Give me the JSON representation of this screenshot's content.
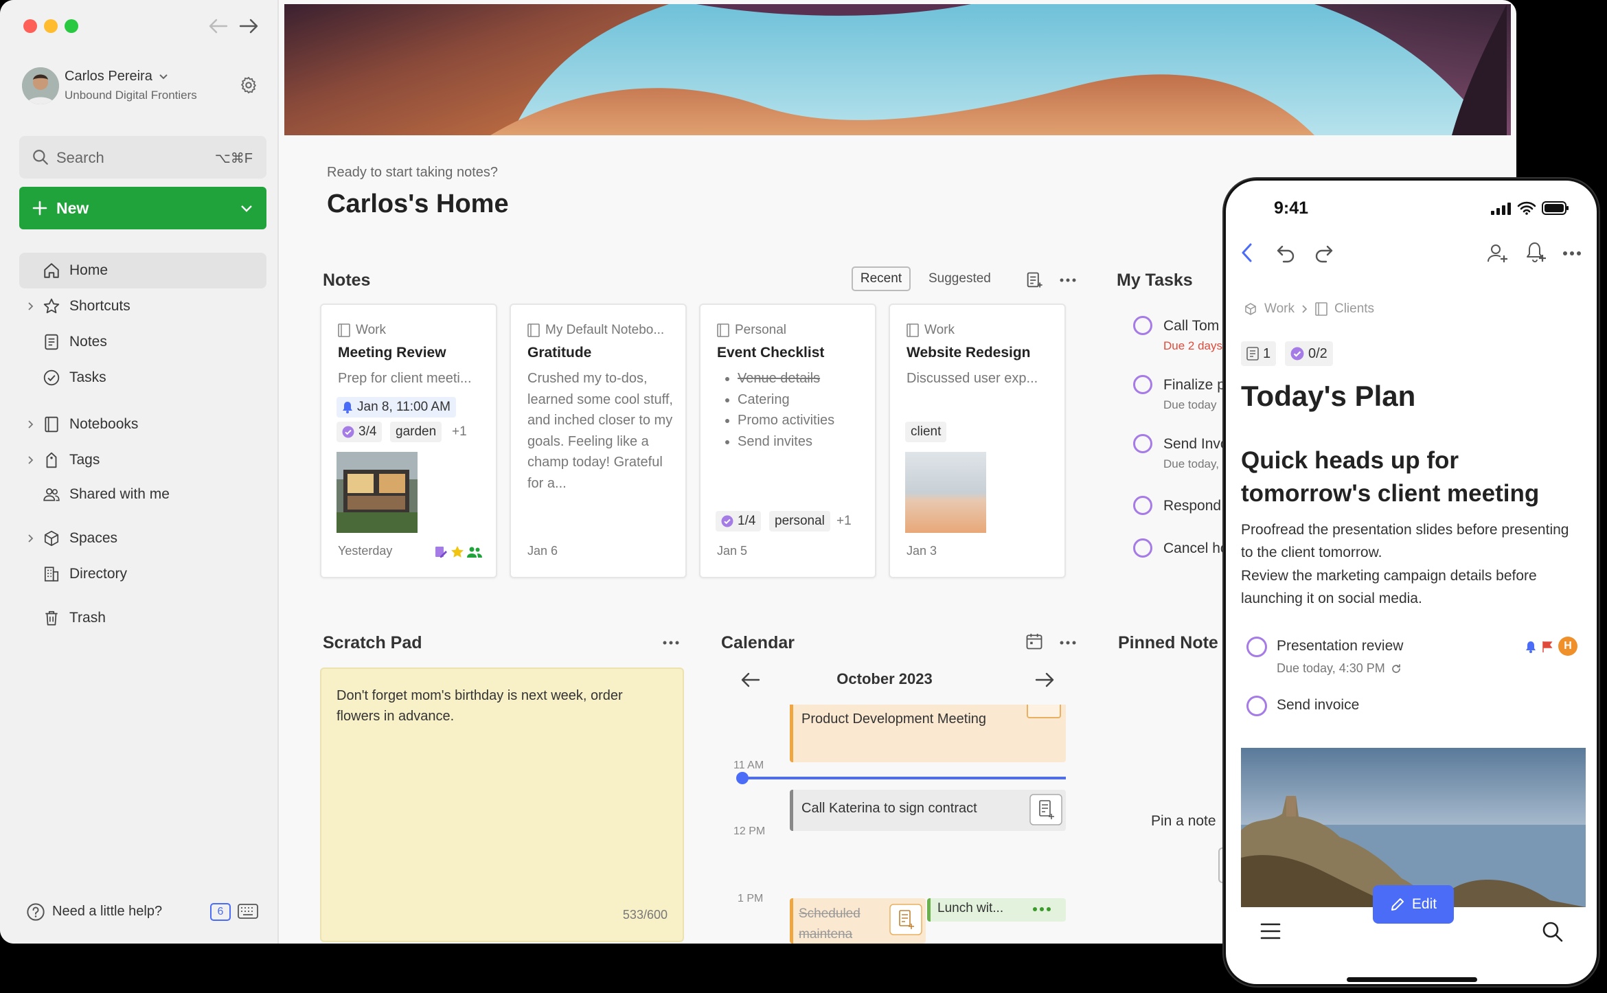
{
  "user": {
    "name": "Carlos Pereira",
    "org": "Unbound Digital Frontiers"
  },
  "search": {
    "label": "Search",
    "shortcut": "⌥⌘F"
  },
  "new_button": {
    "label": "New"
  },
  "nav": {
    "home": "Home",
    "shortcuts": "Shortcuts",
    "notes": "Notes",
    "tasks": "Tasks",
    "notebooks": "Notebooks",
    "tags": "Tags",
    "shared": "Shared with me",
    "spaces": "Spaces",
    "directory": "Directory",
    "trash": "Trash"
  },
  "help": {
    "label": "Need a little help?",
    "badge": "6"
  },
  "home": {
    "subtitle": "Ready to start taking notes?",
    "title": "Carlos's Home"
  },
  "notes_widget": {
    "title": "Notes",
    "tab_recent": "Recent",
    "tab_suggested": "Suggested",
    "cards": [
      {
        "notebook": "Work",
        "title": "Meeting Review",
        "body": "Prep for client meeti...",
        "reminder": "Jan 8, 11:00 AM",
        "tasks": "3/4",
        "tag": "garden",
        "more": "+1",
        "date": "Yesterday"
      },
      {
        "notebook": "My Default Notebo...",
        "title": "Gratitude",
        "body": "Crushed my to-dos, learned some cool stuff, and inched closer to my goals. Feeling like a champ today! Grateful for a...",
        "date": "Jan 6"
      },
      {
        "notebook": "Personal",
        "title": "Event Checklist",
        "list": [
          "Venue details",
          "Catering",
          "Promo activities",
          "Send invites"
        ],
        "tasks": "1/4",
        "tag": "personal",
        "more": "+1",
        "date": "Jan 5"
      },
      {
        "notebook": "Work",
        "title": "Website Redesign",
        "body": "Discussed user exp...",
        "tag": "client",
        "date": "Jan 3"
      }
    ]
  },
  "my_tasks": {
    "title": "My Tasks",
    "items": [
      {
        "name": "Call Tom",
        "due": "Due 2 days",
        "overdue": true
      },
      {
        "name": "Finalize p",
        "due": "Due today"
      },
      {
        "name": "Send Invo",
        "due": "Due today,"
      },
      {
        "name": "Respond",
        "due": ""
      },
      {
        "name": "Cancel ho",
        "due": ""
      }
    ]
  },
  "scratch": {
    "title": "Scratch Pad",
    "text": "Don't forget mom's birthday is next week, order flowers in advance.",
    "count": "533/600"
  },
  "calendar": {
    "title": "Calendar",
    "month": "October 2023",
    "hours": [
      "11 AM",
      "12 PM",
      "1 PM"
    ],
    "events": {
      "product": "Product Development Meeting",
      "call": "Call Katerina to sign contract",
      "scheduled": "Scheduled maintena",
      "lunch": "Lunch wit..."
    }
  },
  "pinned": {
    "title": "Pinned Note",
    "hint": "Pin a note"
  },
  "phone": {
    "time": "9:41",
    "breadcrumb": {
      "space": "Work",
      "notebook": "Clients"
    },
    "counts": {
      "notes": "1",
      "tasks": "0/2"
    },
    "title": "Today's Plan",
    "heading": "Quick heads up for tomorrow's client meeting",
    "para1": "Proofread the presentation slides before presenting to the client tomorrow.",
    "para2": "Review the marketing campaign details before launching it on social media.",
    "tasks": [
      {
        "name": "Presentation review",
        "due": "Due today, 4:30 PM",
        "avatar": "H"
      },
      {
        "name": "Send invoice"
      }
    ],
    "edit": "Edit"
  },
  "colors": {
    "accent_green": "#1fa33a",
    "task_purple": "#a57be6",
    "edit_blue": "#4a6cf7",
    "overdue_red": "#e04a3b"
  }
}
